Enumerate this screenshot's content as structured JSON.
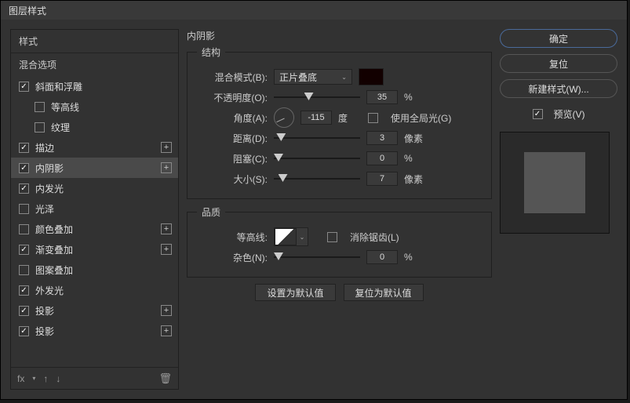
{
  "title": "图层样式",
  "sidebar": {
    "header": "样式",
    "blend_header": "混合选项",
    "items": [
      {
        "label": "斜面和浮雕",
        "checked": true,
        "has_add": false,
        "indent": false
      },
      {
        "label": "等高线",
        "checked": false,
        "has_add": false,
        "indent": true
      },
      {
        "label": "纹理",
        "checked": false,
        "has_add": false,
        "indent": true
      },
      {
        "label": "描边",
        "checked": true,
        "has_add": true,
        "indent": false
      },
      {
        "label": "内阴影",
        "checked": true,
        "has_add": true,
        "indent": false,
        "selected": true
      },
      {
        "label": "内发光",
        "checked": true,
        "has_add": false,
        "indent": false
      },
      {
        "label": "光泽",
        "checked": false,
        "has_add": false,
        "indent": false
      },
      {
        "label": "颜色叠加",
        "checked": false,
        "has_add": true,
        "indent": false
      },
      {
        "label": "渐变叠加",
        "checked": true,
        "has_add": true,
        "indent": false
      },
      {
        "label": "图案叠加",
        "checked": false,
        "has_add": false,
        "indent": false
      },
      {
        "label": "外发光",
        "checked": true,
        "has_add": false,
        "indent": false
      },
      {
        "label": "投影",
        "checked": true,
        "has_add": true,
        "indent": false
      },
      {
        "label": "投影",
        "checked": true,
        "has_add": true,
        "indent": false
      }
    ],
    "fx_label": "fx"
  },
  "panel": {
    "title": "内阴影",
    "structure": {
      "legend": "结构",
      "blend_mode_label": "混合模式(B):",
      "blend_mode_value": "正片叠底",
      "opacity_label": "不透明度(O):",
      "opacity_value": "35",
      "opacity_unit": "%",
      "angle_label": "角度(A):",
      "angle_value": "-115",
      "angle_unit": "度",
      "global_light_label": "使用全局光(G)",
      "distance_label": "距离(D):",
      "distance_value": "3",
      "distance_unit": "像素",
      "choke_label": "阻塞(C):",
      "choke_value": "0",
      "choke_unit": "%",
      "size_label": "大小(S):",
      "size_value": "7",
      "size_unit": "像素"
    },
    "quality": {
      "legend": "品质",
      "contour_label": "等高线:",
      "antialias_label": "消除锯齿(L)",
      "noise_label": "杂色(N):",
      "noise_value": "0",
      "noise_unit": "%"
    },
    "buttons": {
      "make_default": "设置为默认值",
      "reset_default": "复位为默认值"
    }
  },
  "right": {
    "ok": "确定",
    "cancel": "复位",
    "new_style": "新建样式(W)...",
    "preview_label": "预览(V)"
  }
}
